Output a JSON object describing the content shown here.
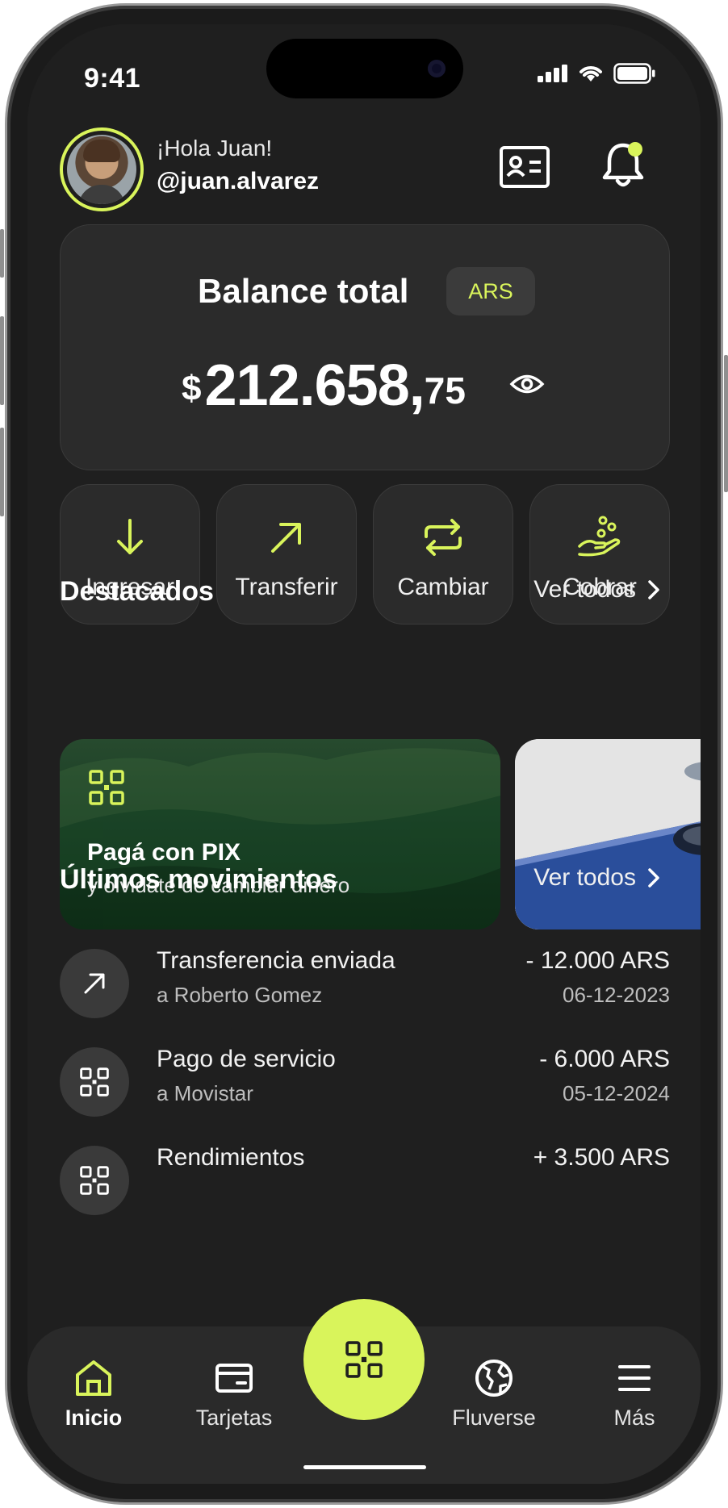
{
  "status": {
    "time": "9:41"
  },
  "header": {
    "greeting": "¡Hola Juan!",
    "handle": "@juan.alvarez"
  },
  "balance": {
    "title": "Balance total",
    "currency": "ARS",
    "symbol": "$",
    "integer": "212.658,",
    "decimals": "75"
  },
  "actions": [
    {
      "label": "Ingresar",
      "icon": "arrow-down-icon"
    },
    {
      "label": "Transferir",
      "icon": "arrow-up-right-icon"
    },
    {
      "label": "Cambiar",
      "icon": "exchange-icon"
    },
    {
      "label": "Cobrar",
      "icon": "hand-coins-icon"
    }
  ],
  "featured": {
    "title": "Destacados",
    "see_all": "Ver todos",
    "promo": {
      "title": "Pagá con PIX",
      "subtitle": "y olvidate de cambiar dinero"
    }
  },
  "movements": {
    "title": "Últimos movimientos",
    "see_all": "Ver todos",
    "items": [
      {
        "name": "Transferencia enviada",
        "sub": "a Roberto Gomez",
        "amount": "- 12.000 ARS",
        "date": "06-12-2023",
        "icon": "arrow-up-right-icon"
      },
      {
        "name": "Pago de servicio",
        "sub": "a Movistar",
        "amount": "- 6.000 ARS",
        "date": "05-12-2024",
        "icon": "qr-icon"
      },
      {
        "name": "Rendimientos",
        "sub": "",
        "amount": "+ 3.500 ARS",
        "date": "",
        "icon": "qr-icon"
      }
    ]
  },
  "nav": [
    {
      "label": "Inicio",
      "icon": "home-icon",
      "active": true
    },
    {
      "label": "Tarjetas",
      "icon": "card-icon"
    },
    {
      "label": "Fluverse",
      "icon": "globe-icon"
    },
    {
      "label": "Más",
      "icon": "menu-icon"
    }
  ],
  "colors": {
    "accent": "#d9f45b",
    "background": "#1f1f1f",
    "card": "#2b2b2b"
  }
}
